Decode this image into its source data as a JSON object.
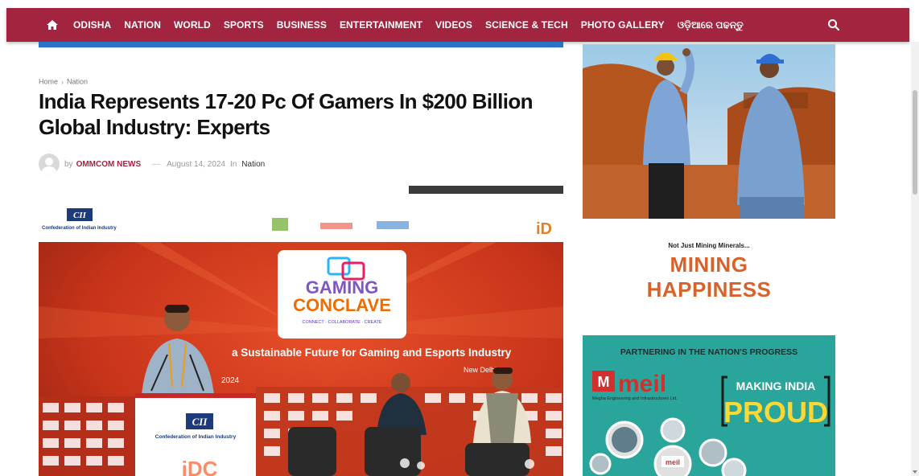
{
  "nav": {
    "items": [
      "ODISHA",
      "NATION",
      "WORLD",
      "SPORTS",
      "BUSINESS",
      "ENTERTAINMENT",
      "VIDEOS",
      "SCIENCE & TECH",
      "PHOTO GALLERY",
      "ଓଡ଼ିଆରେ ପଢନ୍ତୁ"
    ],
    "bg_color": "#a3243f"
  },
  "breadcrumb": {
    "home": "Home",
    "section": "Nation"
  },
  "article": {
    "title": "India Represents 17-20 Pc Of Gamers In $200 Billion Global Industry: Experts",
    "by": "by",
    "author": "OMMCOM NEWS",
    "date": "August 14, 2024",
    "in": "In",
    "category": "Nation"
  },
  "hero": {
    "banner_org": "Confederation of Indian Industry",
    "logo_text": "CII",
    "event_line1": "GAMING",
    "event_line2": "CONCLAVE",
    "event_tagline": "CONNECT · COLLABORATE · CREATE",
    "headline": "a Sustainable Future for Gaming and Esports Industry",
    "location": "New Delhi",
    "year": "2024",
    "podium_org": "Confederation of Indian Industry",
    "podium_logo": "CII"
  },
  "sidebar": {
    "ad2_small": "Not Just Mining Minerals...",
    "ad2_line1": "MINING",
    "ad2_line2": "HAPPINESS",
    "ad3_header": "PARTNERING IN THE NATION'S PROGRESS",
    "ad3_brand": "meil",
    "ad3_sub": "Megha Engineering and Infrastructures Ltd.",
    "ad3_making": "MAKING INDIA",
    "ad3_proud": "PROUD",
    "ad3_small_brand": "meil"
  }
}
